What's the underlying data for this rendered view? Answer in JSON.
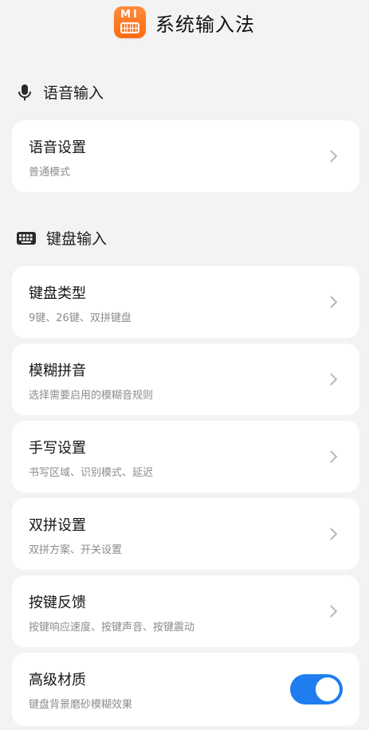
{
  "header": {
    "logo_text": "MI",
    "title": "系统输入法"
  },
  "voice_section": {
    "icon": "microphone-icon",
    "title": "语音输入",
    "items": [
      {
        "title": "语音设置",
        "subtitle": "普通模式"
      }
    ]
  },
  "keyboard_section": {
    "icon": "keyboard-icon",
    "title": "键盘输入",
    "items": [
      {
        "title": "键盘类型",
        "subtitle": "9键、26键、双拼键盘"
      },
      {
        "title": "模糊拼音",
        "subtitle": "选择需要启用的模糊音规则"
      },
      {
        "title": "手写设置",
        "subtitle": "书写区域、识别模式、延迟"
      },
      {
        "title": "双拼设置",
        "subtitle": "双拼方案、开关设置"
      },
      {
        "title": "按键反馈",
        "subtitle": "按键响应速度、按键声音、按键震动"
      },
      {
        "title": "高级材质",
        "subtitle": "键盘背景磨砂模糊效果",
        "toggle_on": true
      }
    ]
  },
  "colors": {
    "accent": "#1f7df0",
    "logo": "#ff6a12",
    "background": "#f3f3f3"
  }
}
